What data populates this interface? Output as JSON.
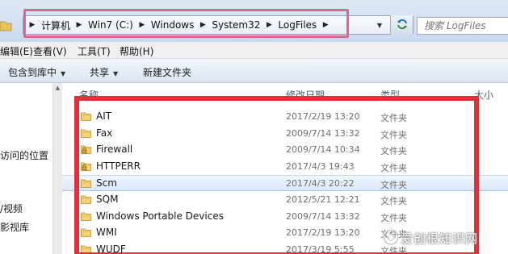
{
  "address_bar": {
    "crumbs": [
      "计算机",
      "Win7 (C:)",
      "Windows",
      "System32",
      "LogFiles"
    ]
  },
  "search": {
    "placeholder": "搜索 LogFiles"
  },
  "menu": {
    "items": [
      "编辑(E)",
      "查看(V)",
      "工具(T)",
      "帮助(H)"
    ]
  },
  "toolbar": {
    "buttons": [
      "包含到库中",
      "共享",
      "新建文件夹"
    ]
  },
  "nav_pane": {
    "items": [
      "",
      "访问的位置",
      "/视频",
      "影视库"
    ]
  },
  "columns": {
    "name": "名称",
    "date": "修改日期",
    "type": "类型",
    "size": "大小"
  },
  "files": [
    {
      "name": "AIT",
      "date": "2017/2/19 13:20",
      "type": "文件夹",
      "locked": false
    },
    {
      "name": "Fax",
      "date": "2009/7/14 13:32",
      "type": "文件夹",
      "locked": false
    },
    {
      "name": "Firewall",
      "date": "2009/7/14 10:34",
      "type": "文件夹",
      "locked": true
    },
    {
      "name": "HTTPERR",
      "date": "2017/4/3 19:43",
      "type": "文件夹",
      "locked": true
    },
    {
      "name": "Scm",
      "date": "2017/4/3 20:22",
      "type": "文件夹",
      "locked": false,
      "selected": true
    },
    {
      "name": "SQM",
      "date": "2012/5/21 12:21",
      "type": "文件夹",
      "locked": false
    },
    {
      "name": "Windows Portable Devices",
      "date": "2009/7/14 13:32",
      "type": "文件夹",
      "locked": false
    },
    {
      "name": "WMI",
      "date": "2017/2/19 13:20",
      "type": "文件夹",
      "locked": false
    },
    {
      "name": "WUDF",
      "date": "2017/3/19 5:55",
      "type": "文件夹",
      "locked": false
    }
  ],
  "watermark": {
    "text": "爱创根知识网"
  },
  "colors": {
    "highlight_address": "#e0668f",
    "highlight_list": "#e0303a",
    "folder": "#f5d27a"
  }
}
